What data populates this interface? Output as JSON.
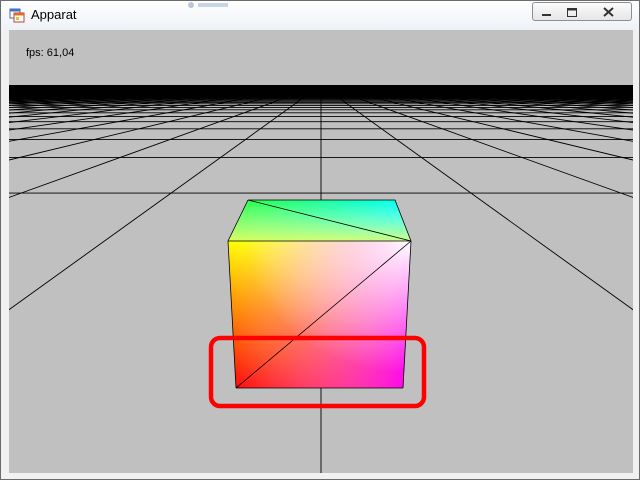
{
  "window": {
    "title": "Apparat",
    "icon": "app-window-icon",
    "controls": [
      "minimize-icon",
      "maximize-icon",
      "close-icon"
    ]
  },
  "viewport": {
    "fps_text": "fps: 61,04",
    "background_color": "#c0c0c0",
    "grid_line_color": "#000000",
    "cube_colors": [
      "#ff0000",
      "#ffff00",
      "#00ff00",
      "#00ffff",
      "#ff00ff",
      "#ffffff"
    ],
    "highlight_color": "#ff0000"
  }
}
